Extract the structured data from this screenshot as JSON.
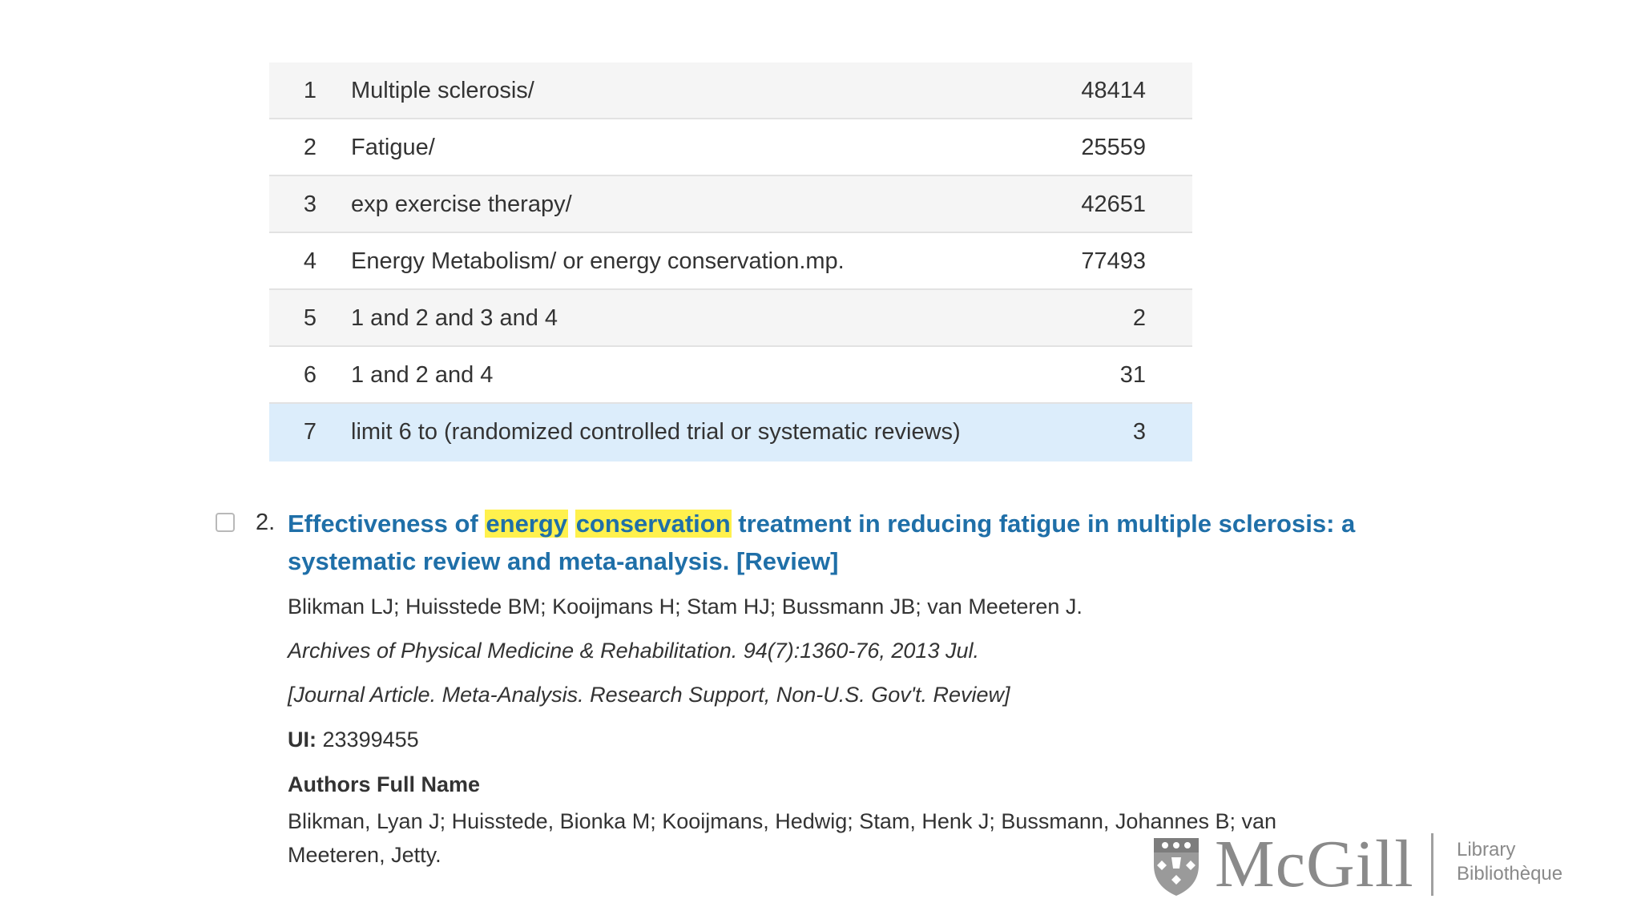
{
  "search_history": [
    {
      "num": "1",
      "query": "Multiple sclerosis/",
      "results": "48414"
    },
    {
      "num": "2",
      "query": "Fatigue/",
      "results": "25559"
    },
    {
      "num": "3",
      "query": "exp exercise therapy/",
      "results": "42651"
    },
    {
      "num": "4",
      "query": "Energy Metabolism/ or energy conservation.mp.",
      "results": "77493"
    },
    {
      "num": "5",
      "query": "1 and 2 and 3 and 4",
      "results": "2"
    },
    {
      "num": "6",
      "query": "1 and 2 and 4",
      "results": "31"
    },
    {
      "num": "7",
      "query": "limit 6 to (randomized controlled trial or systematic reviews)",
      "results": "3"
    }
  ],
  "record": {
    "number": "2.",
    "title_before": "Effectiveness of",
    "title_hl1": "energy",
    "title_hl2": "conservation",
    "title_after": "treatment in reducing fatigue in multiple sclerosis: a systematic review and meta-analysis. [Review]",
    "authors": "Blikman LJ; Huisstede BM; Kooijmans H; Stam HJ; Bussmann JB; van Meeteren J.",
    "source": "Archives of Physical Medicine & Rehabilitation. 94(7):1360-76, 2013 Jul.",
    "publication_type": "[Journal Article. Meta-Analysis. Research Support, Non-U.S. Gov't. Review]",
    "ui_label": "UI:",
    "ui_value": "23399455",
    "full_name_label": "Authors Full Name",
    "full_names": "Blikman, Lyan J; Huisstede, Bionka M; Kooijmans, Hedwig; Stam, Henk J; Bussmann, Johannes B; van Meeteren, Jetty."
  },
  "logo": {
    "wordmark": "McGill",
    "line1": "Library",
    "line2": "Bibliothèque"
  },
  "colors": {
    "title_link": "#1f6fa8",
    "highlight": "#fff14d",
    "selected_row": "#dcedfb"
  }
}
